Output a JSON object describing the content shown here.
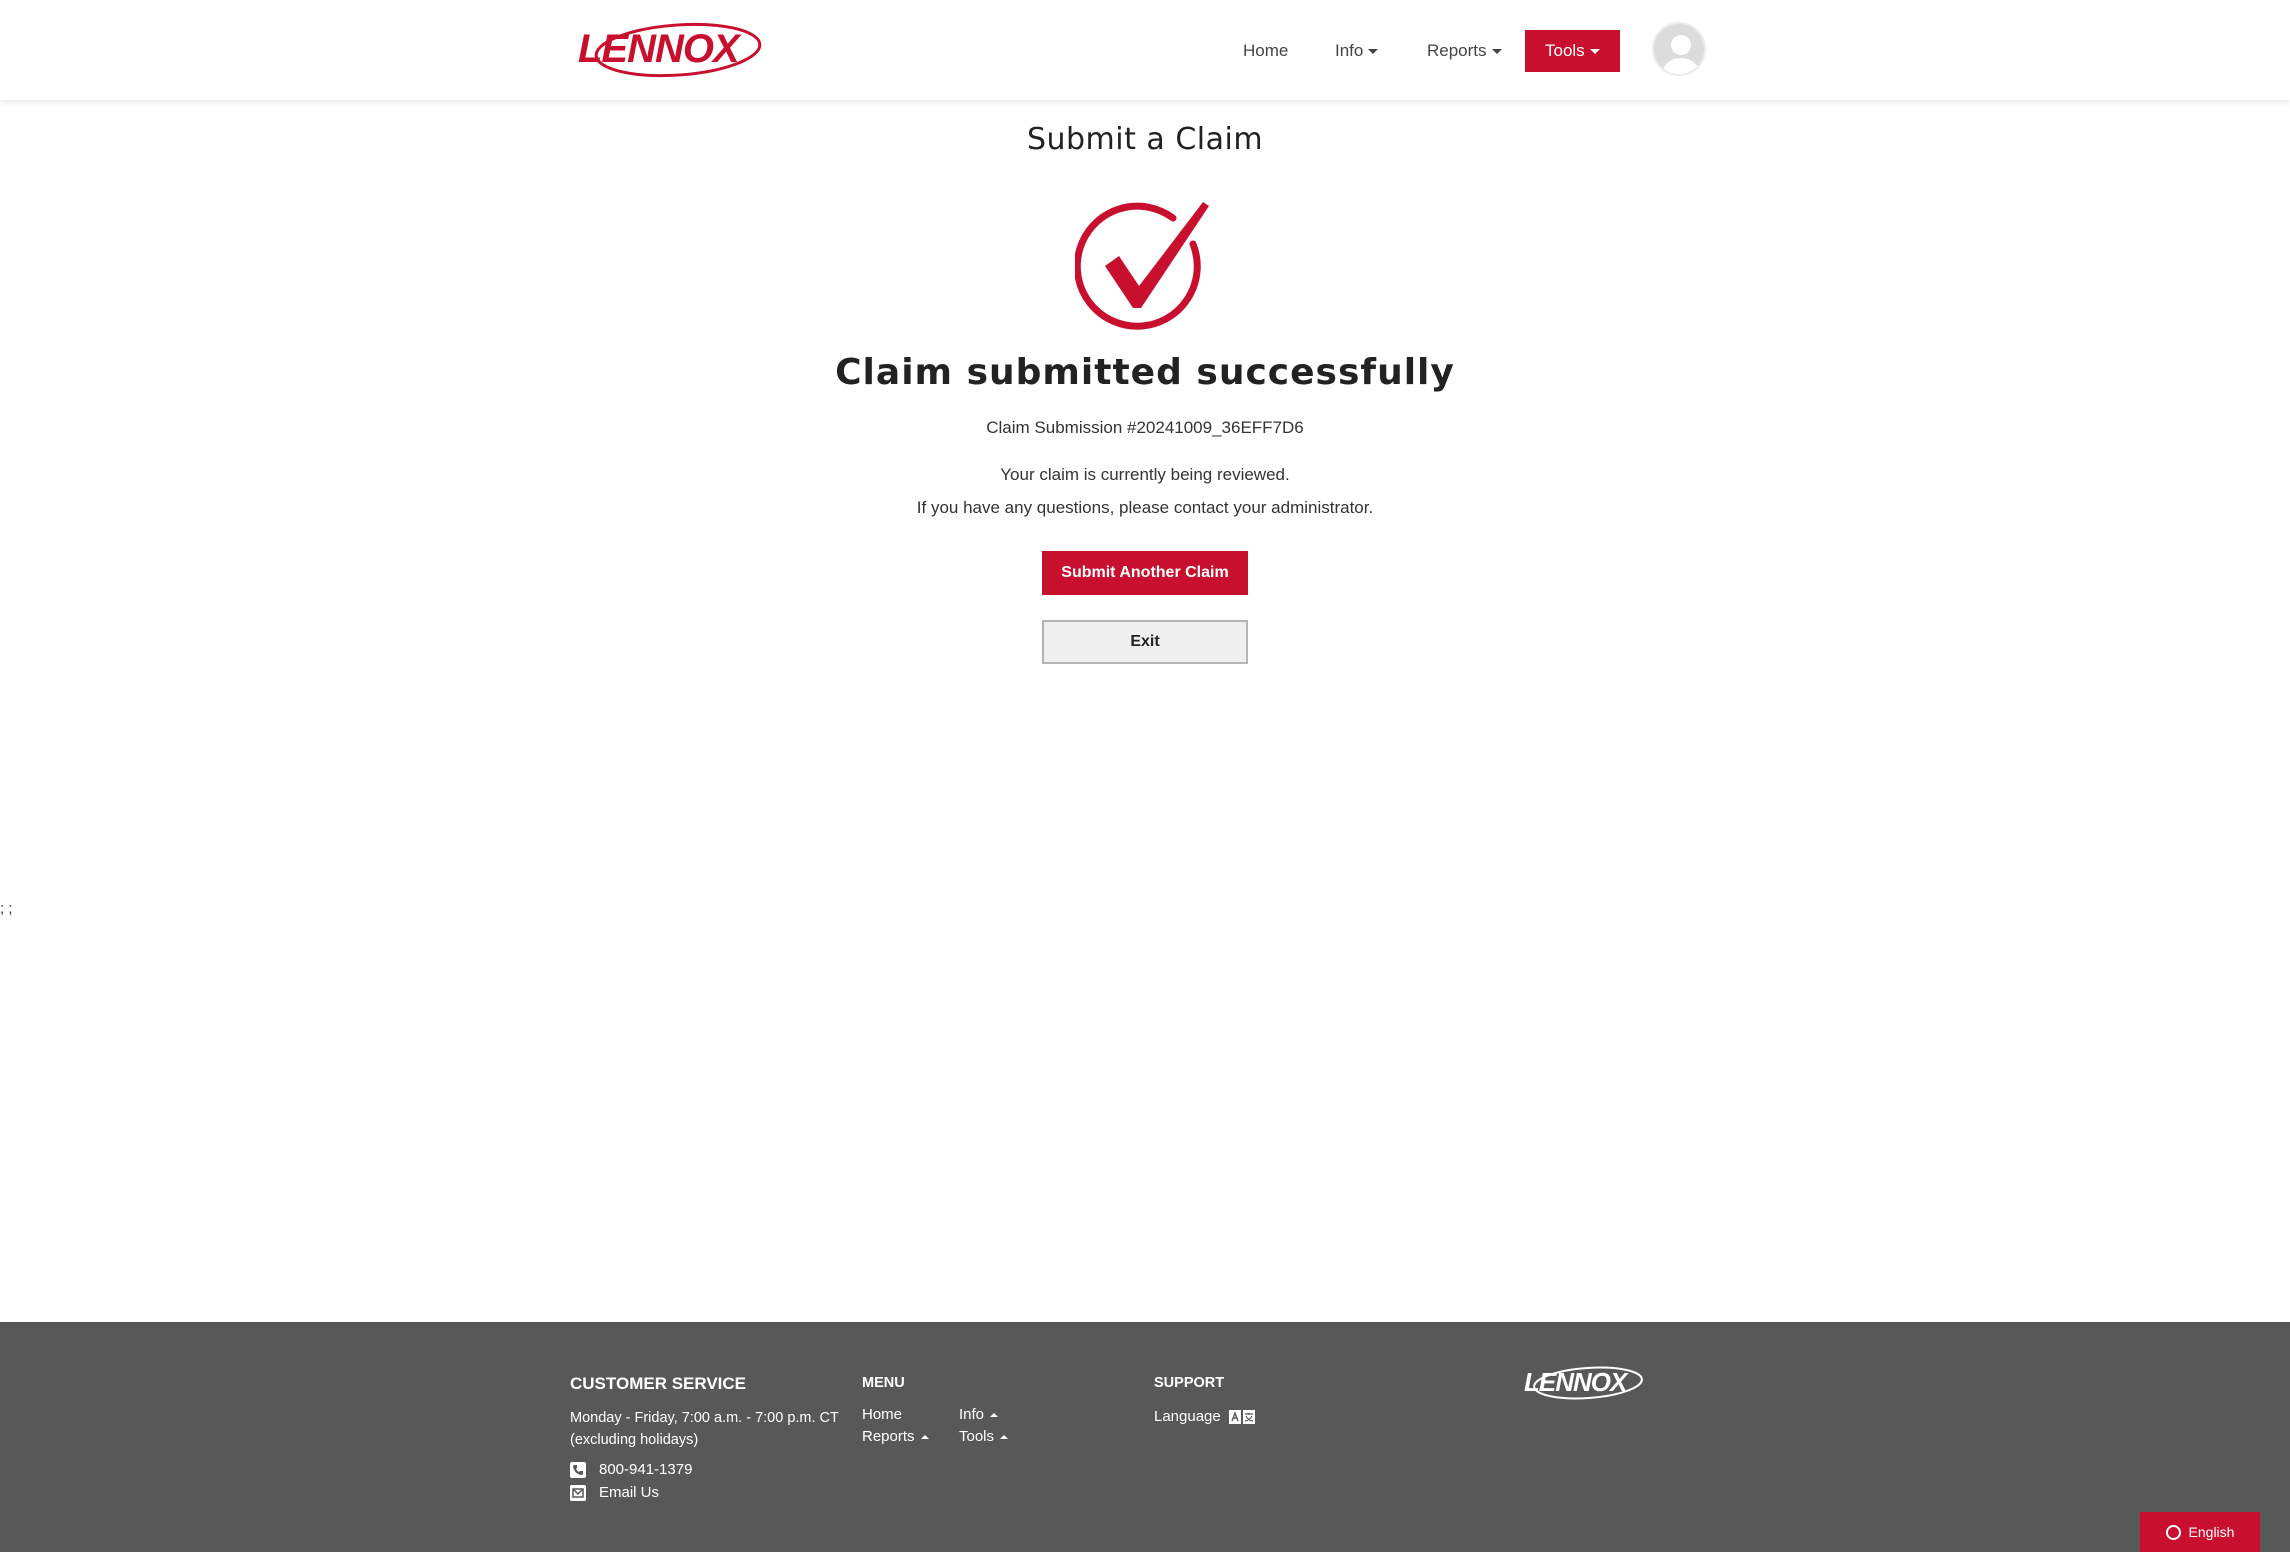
{
  "brand": {
    "name": "LENNOX",
    "accent": "#c8102e"
  },
  "nav": {
    "home": "Home",
    "info": "Info",
    "reports": "Reports",
    "tools": "Tools"
  },
  "main": {
    "title": "Submit a Claim",
    "success_title": "Claim submitted successfully",
    "submission_id": "Claim Submission #20241009_36EFF7D6",
    "message_line1": "Your claim is currently being reviewed.",
    "message_line2": "If you have any questions, please contact your administrator.",
    "submit_another_label": "Submit Another Claim",
    "exit_label": "Exit",
    "stray_text": "; ;"
  },
  "footer": {
    "customer_service": {
      "heading": "CUSTOMER SERVICE",
      "hours_line1": "Monday - Friday, 7:00 a.m. - 7:00 p.m. CT",
      "hours_line2": "(excluding holidays)",
      "phone": "800-941-1379",
      "email": "Email Us"
    },
    "menu": {
      "heading": "MENU",
      "home": "Home",
      "info": "Info",
      "reports": "Reports",
      "tools": "Tools"
    },
    "support": {
      "heading": "SUPPORT",
      "language": "Language"
    },
    "language_button": "English"
  },
  "icons": [
    "user-avatar-icon",
    "checkmark-circle-icon",
    "phone-icon",
    "mail-icon",
    "translate-icon",
    "globe-ring-icon"
  ]
}
